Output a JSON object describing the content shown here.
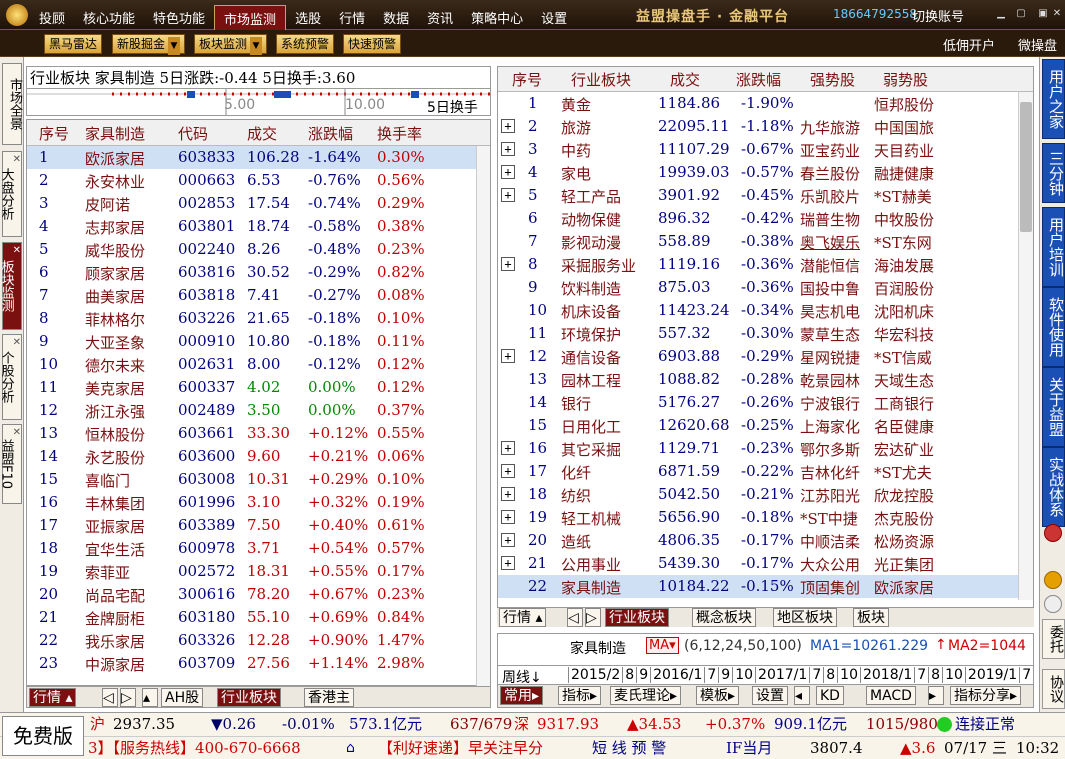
{
  "menu": {
    "items": [
      "投顾",
      "核心功能",
      "特色功能",
      "市场监测",
      "选股",
      "行情",
      "数据",
      "资讯",
      "策略中心",
      "设置"
    ],
    "active": "市场监测"
  },
  "brand": "益盟操盘手 · 金融平台",
  "phone": "18664792558",
  "switch_account": "切换账号",
  "toolbar": {
    "buttons": [
      "黑马雷达",
      "新股掘金",
      "板块监测",
      "系统预警",
      "快速预警"
    ],
    "low_account": "低佣开户",
    "micro": "微操盘"
  },
  "left_tabs": [
    "市场全景",
    "大盘分析",
    "板块监测",
    "个股分析",
    "益盟F10"
  ],
  "left_panel": {
    "info": "行业板块  家具制造 5日涨跌:-0.44 5日换手:3.60",
    "scale": [
      "5.00",
      "10.00"
    ],
    "scale_label": "5日换手",
    "columns": [
      "序号",
      "家具制造",
      "代码",
      "成交",
      "涨跌幅",
      "换手率"
    ],
    "rows": [
      [
        "1",
        "欧派家居",
        "603833",
        "106.28",
        "-1.64%",
        "0.30%"
      ],
      [
        "2",
        "永安林业",
        "000663",
        "6.53",
        "-0.76%",
        "0.56%"
      ],
      [
        "3",
        "皮阿诺",
        "002853",
        "17.54",
        "-0.74%",
        "0.29%"
      ],
      [
        "4",
        "志邦家居",
        "603801",
        "18.74",
        "-0.58%",
        "0.38%"
      ],
      [
        "5",
        "威华股份",
        "002240",
        "8.26",
        "-0.48%",
        "0.23%"
      ],
      [
        "6",
        "顾家家居",
        "603816",
        "30.52",
        "-0.29%",
        "0.82%"
      ],
      [
        "7",
        "曲美家居",
        "603818",
        "7.41",
        "-0.27%",
        "0.08%"
      ],
      [
        "8",
        "菲林格尔",
        "603226",
        "21.65",
        "-0.18%",
        "0.10%"
      ],
      [
        "9",
        "大亚圣象",
        "000910",
        "10.80",
        "-0.18%",
        "0.11%"
      ],
      [
        "10",
        "德尔未来",
        "002631",
        "8.00",
        "-0.12%",
        "0.12%"
      ],
      [
        "11",
        "美克家居",
        "600337",
        "4.02",
        "0.00%",
        "0.12%"
      ],
      [
        "12",
        "浙江永强",
        "002489",
        "3.50",
        "0.00%",
        "0.37%"
      ],
      [
        "13",
        "恒林股份",
        "603661",
        "33.30",
        "+0.12%",
        "0.55%"
      ],
      [
        "14",
        "永艺股份",
        "603600",
        "9.60",
        "+0.21%",
        "0.06%"
      ],
      [
        "15",
        "喜临门",
        "603008",
        "10.31",
        "+0.29%",
        "0.10%"
      ],
      [
        "16",
        "丰林集团",
        "601996",
        "3.10",
        "+0.32%",
        "0.19%"
      ],
      [
        "17",
        "亚振家居",
        "603389",
        "7.50",
        "+0.40%",
        "0.61%"
      ],
      [
        "18",
        "宜华生活",
        "600978",
        "3.71",
        "+0.54%",
        "0.57%"
      ],
      [
        "19",
        "索菲亚",
        "002572",
        "18.31",
        "+0.55%",
        "0.17%"
      ],
      [
        "20",
        "尚品宅配",
        "300616",
        "78.20",
        "+0.67%",
        "0.23%"
      ],
      [
        "21",
        "金牌厨柜",
        "603180",
        "55.10",
        "+0.69%",
        "0.84%"
      ],
      [
        "22",
        "我乐家居",
        "603326",
        "12.28",
        "+0.90%",
        "1.47%"
      ],
      [
        "23",
        "中源家居",
        "603709",
        "27.56",
        "+1.14%",
        "2.98%"
      ]
    ],
    "bottom_tabs": [
      "行情",
      "AH股",
      "行业板块",
      "香港主"
    ]
  },
  "right_panel": {
    "columns": [
      "序号",
      "行业板块",
      "成交",
      "涨跌幅",
      "强势股",
      "弱势股"
    ],
    "rows": [
      {
        "no": "1",
        "name": "黄金",
        "vol": "1184.86",
        "chg": "-1.90%",
        "strong": "",
        "weak": "恒邦股份",
        "plus": false
      },
      {
        "no": "2",
        "name": "旅游",
        "vol": "22095.11",
        "chg": "-1.18%",
        "strong": "九华旅游",
        "weak": "中国国旅",
        "plus": true
      },
      {
        "no": "3",
        "name": "中药",
        "vol": "11107.29",
        "chg": "-0.67%",
        "strong": "亚宝药业",
        "weak": "天目药业",
        "plus": true
      },
      {
        "no": "4",
        "name": "家电",
        "vol": "19939.03",
        "chg": "-0.57%",
        "strong": "春兰股份",
        "weak": "融捷健康",
        "plus": true
      },
      {
        "no": "5",
        "name": "轻工产品",
        "vol": "3901.92",
        "chg": "-0.45%",
        "strong": "乐凯胶片",
        "weak": "*ST赫美",
        "plus": true
      },
      {
        "no": "6",
        "name": "动物保健",
        "vol": "896.32",
        "chg": "-0.42%",
        "strong": "瑞普生物",
        "weak": "中牧股份",
        "plus": false
      },
      {
        "no": "7",
        "name": "影视动漫",
        "vol": "558.89",
        "chg": "-0.38%",
        "strong": "奥飞娱乐",
        "weak": "*ST东网",
        "plus": false
      },
      {
        "no": "8",
        "name": "采掘服务业",
        "vol": "1119.16",
        "chg": "-0.36%",
        "strong": "潜能恒信",
        "weak": "海油发展",
        "plus": true
      },
      {
        "no": "9",
        "name": "饮料制造",
        "vol": "875.03",
        "chg": "-0.36%",
        "strong": "国投中鲁",
        "weak": "百润股份",
        "plus": false
      },
      {
        "no": "10",
        "name": "机床设备",
        "vol": "11423.24",
        "chg": "-0.34%",
        "strong": "昊志机电",
        "weak": "沈阳机床",
        "plus": false
      },
      {
        "no": "11",
        "name": "环境保护",
        "vol": "557.32",
        "chg": "-0.30%",
        "strong": "蒙草生态",
        "weak": "华宏科技",
        "plus": false
      },
      {
        "no": "12",
        "name": "通信设备",
        "vol": "6903.88",
        "chg": "-0.29%",
        "strong": "星网锐捷",
        "weak": "*ST信威",
        "plus": true
      },
      {
        "no": "13",
        "name": "园林工程",
        "vol": "1088.82",
        "chg": "-0.28%",
        "strong": "乾景园林",
        "weak": "天域生态",
        "plus": false
      },
      {
        "no": "14",
        "name": "银行",
        "vol": "5176.27",
        "chg": "-0.26%",
        "strong": "宁波银行",
        "weak": "工商银行",
        "plus": false
      },
      {
        "no": "15",
        "name": "日用化工",
        "vol": "12620.68",
        "chg": "-0.25%",
        "strong": "上海家化",
        "weak": "名臣健康",
        "plus": false
      },
      {
        "no": "16",
        "name": "其它采掘",
        "vol": "1129.71",
        "chg": "-0.23%",
        "strong": "鄂尔多斯",
        "weak": "宏达矿业",
        "plus": true
      },
      {
        "no": "17",
        "name": "化纤",
        "vol": "6871.59",
        "chg": "-0.22%",
        "strong": "吉林化纤",
        "weak": "*ST尤夫",
        "plus": true
      },
      {
        "no": "18",
        "name": "纺织",
        "vol": "5042.50",
        "chg": "-0.21%",
        "strong": "江苏阳光",
        "weak": "欣龙控股",
        "plus": true
      },
      {
        "no": "19",
        "name": "轻工机械",
        "vol": "5656.90",
        "chg": "-0.18%",
        "strong": "*ST中捷",
        "weak": "杰克股份",
        "plus": true
      },
      {
        "no": "20",
        "name": "造纸",
        "vol": "4806.35",
        "chg": "-0.17%",
        "strong": "中顺洁柔",
        "weak": "松炀资源",
        "plus": true
      },
      {
        "no": "21",
        "name": "公用事业",
        "vol": "5439.30",
        "chg": "-0.17%",
        "strong": "大众公用",
        "weak": "光正集团",
        "plus": true
      },
      {
        "no": "22",
        "name": "家具制造",
        "vol": "10184.22",
        "chg": "-0.15%",
        "strong": "顶固集创",
        "weak": "欧派家居",
        "plus": false
      }
    ],
    "bottom_tabs": [
      "行情",
      "行业板块",
      "概念板块",
      "地区板块",
      "板块"
    ]
  },
  "chart_panel": {
    "title": "家具制造",
    "ma_label": "MA",
    "params": "(6,12,24,50,100)",
    "ma1": "MA1=10261.229",
    "ma2": "MA2=1044",
    "period": "周线",
    "dates": [
      "2015/2",
      "8",
      "9",
      "2016/1",
      "7",
      "9",
      "10",
      "2017/1",
      "7",
      "8",
      "10",
      "2018/1",
      "7",
      "8",
      "10",
      "2019/1",
      "7"
    ],
    "bottom": [
      "常用",
      "指标",
      "麦氏理论",
      "模板",
      "设置",
      "KD",
      "MACD",
      "指标分享"
    ]
  },
  "right_bar": [
    "用户之家",
    "三分钟",
    "用户培训",
    "软件使用",
    "关于益盟",
    "实战体系",
    "委托",
    "协议"
  ],
  "status1": {
    "sh_label": "沪",
    "sh_idx": "2937.35",
    "sh_chg": "▼0.26",
    "sh_pct": "-0.01%",
    "sh_amt": "573.1亿元",
    "sh_ud": "637/679",
    "sz_label": "深",
    "sz_idx": "9317.93",
    "sz_chg": "▲34.53",
    "sz_pct": "+0.37%",
    "sz_amt": "909.1亿元",
    "sz_ud": "1015/980",
    "conn": "连接正常"
  },
  "status2": {
    "free": "免费版",
    "hotline": "3】【服务热线】400-670-6668",
    "news": "【利好速递】早关注早分",
    "warn": "短 线 预 警",
    "if_label": "IF当月",
    "if_val": "3807.4",
    "if_chg": "▲3.6",
    "date": "07/17 三",
    "time": "10:32"
  }
}
